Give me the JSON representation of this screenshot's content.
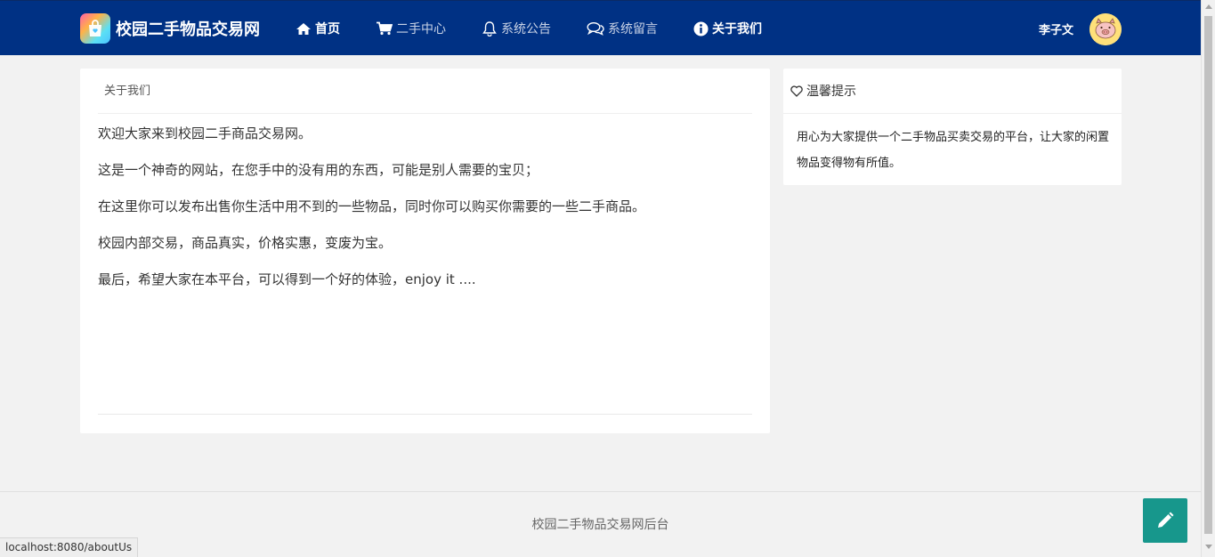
{
  "header": {
    "brand_title": "校园二手物品交易网",
    "nav": [
      {
        "label": "首页",
        "icon": "home-icon"
      },
      {
        "label": "二手中心",
        "icon": "cart-icon"
      },
      {
        "label": "系统公告",
        "icon": "bell-icon"
      },
      {
        "label": "系统留言",
        "icon": "chat-icon"
      },
      {
        "label": "关于我们",
        "icon": "info-icon"
      }
    ],
    "user_name": "李子文"
  },
  "main": {
    "title": "关于我们",
    "paragraphs": [
      "欢迎大家来到校园二手商品交易网。",
      "这是一个神奇的网站，在您手中的没有用的东西，可能是别人需要的宝贝；",
      "在这里你可以发布出售你生活中用不到的一些物品，同时你可以购买你需要的一些二手商品。",
      "校园内部交易，商品真实，价格实惠，变废为宝。",
      "最后，希望大家在本平台，可以得到一个好的体验，enjoy it ...."
    ]
  },
  "sidebar": {
    "title": "温馨提示",
    "text": "用心为大家提供一个二手物品买卖交易的平台，让大家的闲置物品变得物有所值。"
  },
  "footer": {
    "text": "校园二手物品交易网后台"
  },
  "status_bar": {
    "url": "localhost:8080/aboutUs"
  },
  "colors": {
    "navbar": "#003184",
    "fab": "#17978c"
  }
}
